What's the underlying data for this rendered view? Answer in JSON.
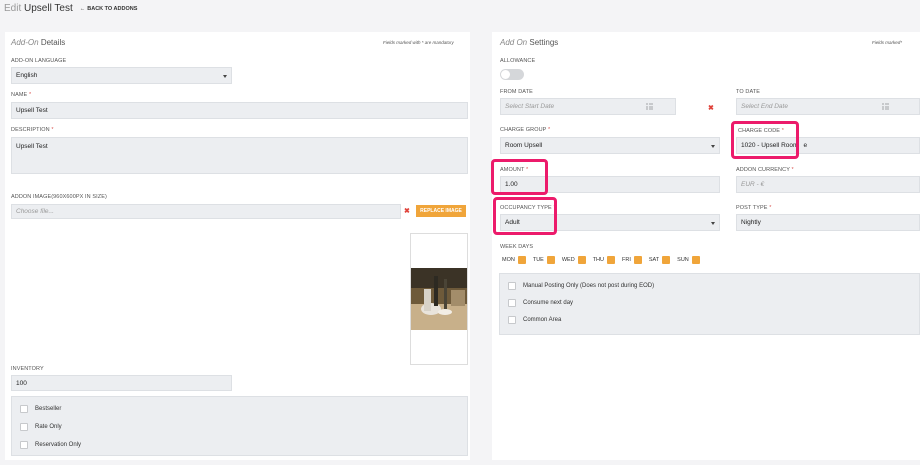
{
  "header": {
    "edit_prefix": "Edit",
    "title": "Upsell Test",
    "back_label": "BACK TO ADDONS"
  },
  "left": {
    "section_title_italic": "Add-On",
    "section_title": "Details",
    "mandatory_note": "Fields marked with * are mandatory",
    "language_label": "ADD-ON LANGUAGE",
    "language_value": "English",
    "name_label": "NAME",
    "name_value": "Upsell Test",
    "description_label": "DESCRIPTION",
    "description_value": "Upsell Test",
    "image_label": "ADDON IMAGE(960X600PX IN SIZE)",
    "image_placeholder": "Choose file...",
    "replace_label": "REPLACE IMAGE",
    "inventory_label": "INVENTORY",
    "inventory_value": "100",
    "checkboxes": [
      "Bestseller",
      "Rate Only",
      "Reservation Only"
    ]
  },
  "right": {
    "section_title_italic": "Add On",
    "section_title": "Settings",
    "mandatory_note": "Fields marked*",
    "allowance_label": "ALLOWANCE",
    "from_date_label": "FROM DATE",
    "from_date_placeholder": "Select Start Date",
    "to_date_label": "TO DATE",
    "to_date_placeholder": "Select End Date",
    "charge_group_label": "CHARGE GROUP",
    "charge_group_value": "Room Upsell",
    "charge_code_label": "CHARGE CODE",
    "charge_code_value": "1020 - Upsell Room",
    "charge_code_overflow": "e",
    "amount_label": "AMOUNT",
    "amount_value": "1.00",
    "currency_label": "ADDON CURRENCY",
    "currency_value": "EUR - €",
    "occupancy_label": "OCCUPANCY TYPE",
    "occupancy_value": "Adult",
    "post_type_label": "POST TYPE",
    "post_type_value": "Nightly",
    "week_days_label": "WEEK DAYS",
    "week_days": [
      "MON",
      "TUE",
      "WED",
      "THU",
      "FRI",
      "SAT",
      "SUN"
    ],
    "checkboxes": [
      "Manual Posting Only (Does not post during EOD)",
      "Consume next day",
      "Common Area"
    ]
  },
  "colors": {
    "highlight": "#ec1b6b",
    "accent": "#f0a53a",
    "remove": "#e0433b"
  }
}
